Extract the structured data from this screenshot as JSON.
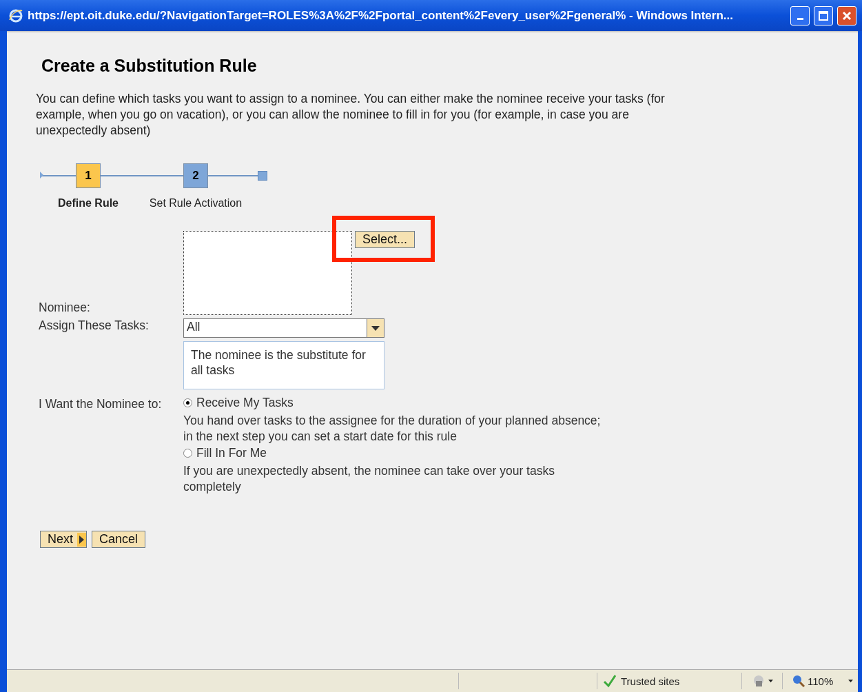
{
  "window": {
    "title": "https://ept.oit.duke.edu/?NavigationTarget=ROLES%3A%2F%2Fportal_content%2Fevery_user%2Fgeneral% - Windows Intern..."
  },
  "page": {
    "heading": "Create a Substitution Rule",
    "intro": "You can define which tasks you want to assign to a nominee. You can either make the nominee receive your tasks (for example, when you go on vacation), or you can allow the nominee to fill in for you (for example, in case you are unexpectedly absent)"
  },
  "steps": [
    {
      "number": "1",
      "label": "Define Rule",
      "selected": true
    },
    {
      "number": "2",
      "label": "Set Rule Activation",
      "selected": false
    }
  ],
  "form": {
    "nominee_label": "Nominee:",
    "select_button": "Select...",
    "highlighted": true,
    "tasks_label": "Assign These Tasks:",
    "tasks_value": "All",
    "tasks_description": "The nominee is the substitute for all tasks",
    "mode_label": "I Want the Nominee to:",
    "options": [
      {
        "label": "Receive My Tasks",
        "description": "You hand over tasks to the assignee for the duration of your planned absence; in the next step you can set a start date for this rule",
        "selected": true
      },
      {
        "label": "Fill In For Me",
        "description": "If you are unexpectedly absent, the nominee can take over your tasks completely",
        "selected": false
      }
    ]
  },
  "buttons": [
    {
      "label": "Next",
      "kind": "next"
    },
    {
      "label": "Cancel",
      "kind": "plain"
    }
  ],
  "status_bar": {
    "zone": "Trusted sites",
    "zoom": "110%"
  }
}
